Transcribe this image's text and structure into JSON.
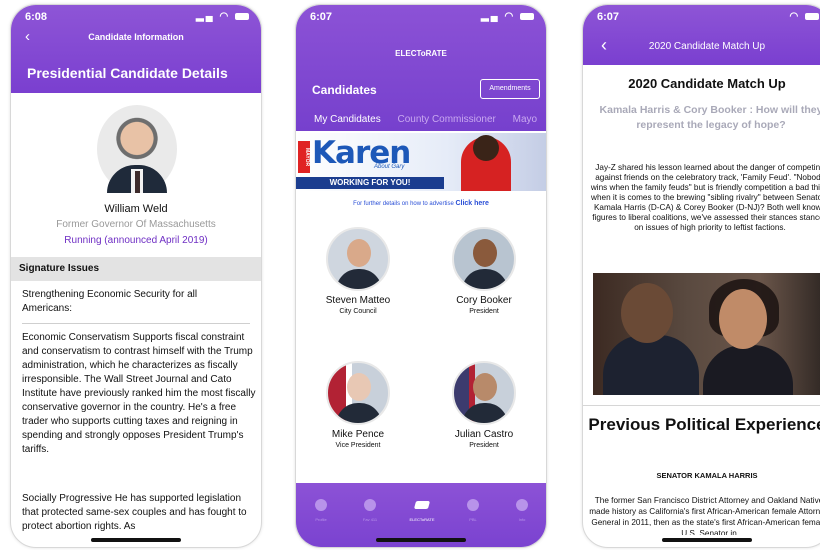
{
  "colors": {
    "accent": "#7a3fd0",
    "link": "#2a4fd6",
    "running": "#6f2fc4"
  },
  "phone1": {
    "time": "6:08",
    "nav_title": "Candidate Information",
    "page_title": "Presidential Candidate Details",
    "candidate_name": "William Weld",
    "candidate_role": "Former Governor Of Massachusetts",
    "candidate_status": "Running (announced April 2019)",
    "section_title": "Signature Issues",
    "issue_title": "Strengthening Economic Security for all Americans:",
    "issue_body": "Economic Conservatism Supports fiscal constraint and conservatism to contrast himself with the Trump administration, which he characterizes as fiscally irresponsible. The Wall Street Journal and Cato Institute have previously ranked him the most fiscally conservative governor in the country. He's a free trader who supports cutting taxes and reigning in spending and strongly opposes President Trump's tariffs.",
    "issue_body2": "Socially Progressive He has supported legislation that protected same-sex couples and has fought to protect abortion rights. As"
  },
  "phone2": {
    "time": "6:07",
    "app_title": "ELECToRATE",
    "screen_title": "Candidates",
    "amendments_label": "Amendments",
    "tabs": [
      "My Candidates",
      "County Commissioner",
      "Mayo"
    ],
    "ad": {
      "mayor": "MAYOR",
      "name": "Karen",
      "about": "About Gary",
      "tagline": "WORKING FOR YOU!"
    },
    "advertise_text": "For further details on how to advertise",
    "advertise_link": "Click here",
    "candidates": [
      {
        "name": "Steven Matteo",
        "position": "City Council"
      },
      {
        "name": "Cory Booker",
        "position": "President"
      },
      {
        "name": "Mike Pence",
        "position": "Vice President"
      },
      {
        "name": "Julian Castro",
        "position": "President"
      }
    ],
    "tabbar": [
      {
        "label": "Profile",
        "icon": "profile-icon"
      },
      {
        "label": "Fav 411",
        "icon": "flame-icon"
      },
      {
        "label": "ELECToRATE",
        "icon": "vote-icon"
      },
      {
        "label": "PBL",
        "icon": "location-icon"
      },
      {
        "label": "Info",
        "icon": "help-icon"
      }
    ]
  },
  "phone3": {
    "time": "6:07",
    "nav_title": "2020 Candidate Match Up",
    "heading": "2020 Candidate Match Up",
    "subheading": "Kamala Harris & Cory Booker : How will they represent the legacy of hope?",
    "paragraph": "Jay-Z shared his lesson learned about the danger of competing against friends on the celebratory track, 'Family Feud'. \"Nobody wins when the family feuds\" but is friendly competition a bad thing when it is comes to the brewing \"sibling rivalry\" between Senators Kamala Harris (D-CA) & Corey Booker (D-NJ)? Both well known figures to liberal coalitions, we've assessed their stances stances on issues of high priority to leftist factions.",
    "section_heading": "Previous Political Experience",
    "senator_label": "SENATOR KAMALA HARRIS",
    "paragraph2": "The former San Francisco District Attorney and Oakland Native made history as California's first African-American female Attorney General in 2011, then as the state's first African-American female U.S. Senator in"
  }
}
